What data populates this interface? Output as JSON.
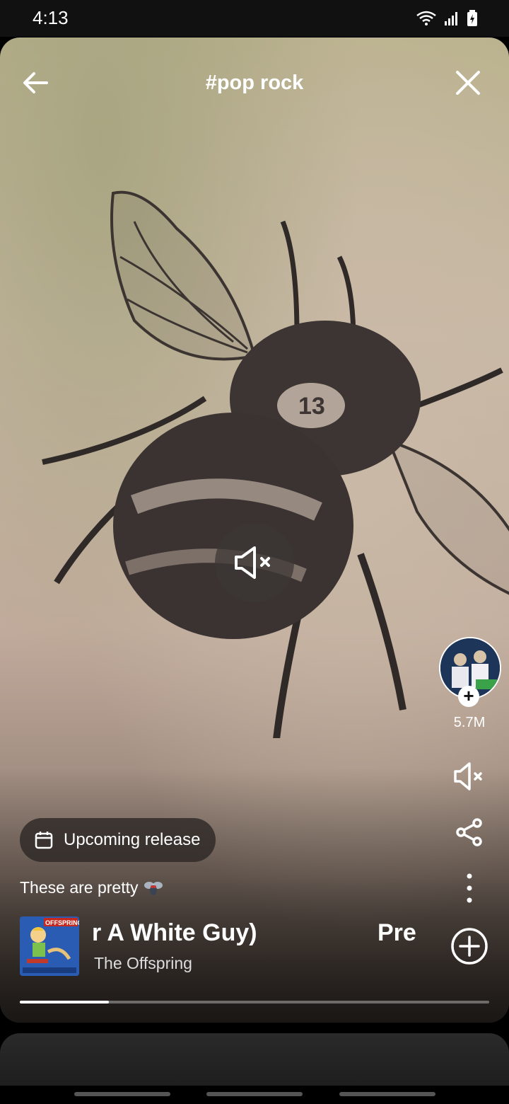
{
  "status": {
    "time": "4:13"
  },
  "header": {
    "title": "#pop rock"
  },
  "sidebar": {
    "follower_count": "5.7M"
  },
  "pill": {
    "label": "Upcoming release"
  },
  "post": {
    "caption": "These are pretty"
  },
  "track": {
    "title_visible": "r A White Guy)",
    "next_title_visible": "Pre",
    "artist": "The Offspring",
    "progress_fraction": 0.19
  },
  "album_art": {
    "text": "OFFSPRING"
  },
  "icons": [
    "back-arrow-icon",
    "close-icon",
    "mute-icon",
    "share-icon",
    "more-vertical-icon",
    "add-circle-icon",
    "calendar-icon",
    "fly-emoji-icon",
    "wifi-icon",
    "signal-icon",
    "battery-icon"
  ]
}
